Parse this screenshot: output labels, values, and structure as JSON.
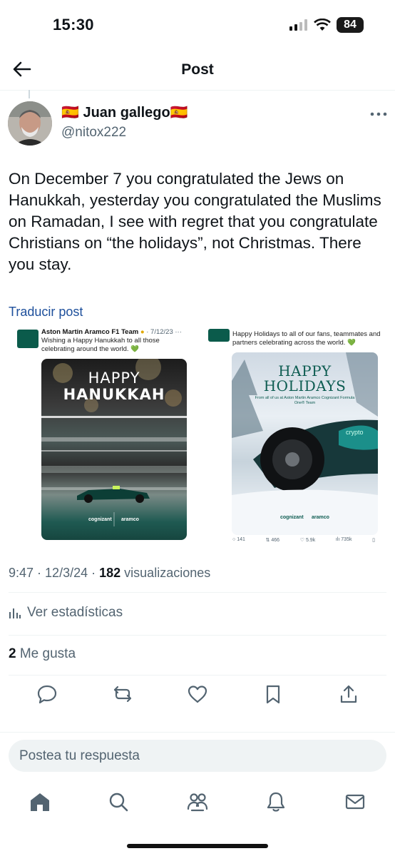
{
  "status_bar": {
    "time": "15:30",
    "battery": "84"
  },
  "header": {
    "title": "Post"
  },
  "author": {
    "flag_left": "🇪🇸",
    "name": "Juan gallego",
    "flag_right": "🇪🇸",
    "handle": "@nitox222"
  },
  "tweet": {
    "text": "On December 7 you congratulated the Jews on Hanukkah, yesterday you congratulated the Muslims on Ramadan, I see with regret that you congratulate Christians on “the holidays”, not Christmas. There you stay.",
    "translate_label": "Traducir post"
  },
  "embedded": {
    "left": {
      "author": "Aston Martin Aramco F1 Team",
      "date": "· 7/12/23",
      "text": "Wishing a Happy Hanukkah to all those celebrating around the world.",
      "heart": "💚",
      "poster_line1": "HAPPY",
      "poster_line2": "HANUKKAH",
      "sponsor1": "cognizant",
      "sponsor2": "aramco"
    },
    "right": {
      "text": "Happy Holidays to all of our fans, teammates and partners celebrating across the world.",
      "heart": "💚",
      "poster_line1": "HAPPY",
      "poster_line2": "HOLIDAYS",
      "poster_sub": "From all of us at Aston Martin Aramco Cognizant Formula One® Team",
      "sponsor1": "cognizant",
      "sponsor2": "aramco",
      "stats": [
        "141",
        "466",
        "5.9k",
        "735k"
      ]
    }
  },
  "meta": {
    "time": "9:47",
    "date": "12/3/24",
    "views_count": "182",
    "views_label": "visualizaciones"
  },
  "stats_link": "Ver estadísticas",
  "likes": {
    "count": "2",
    "label": "Me gusta"
  },
  "reply": {
    "placeholder": "Postea tu respuesta"
  },
  "colors": {
    "accent": "#1d9bf0",
    "text": "#0f1419",
    "secondary": "#536471",
    "aston_green": "#0b5b4b"
  }
}
